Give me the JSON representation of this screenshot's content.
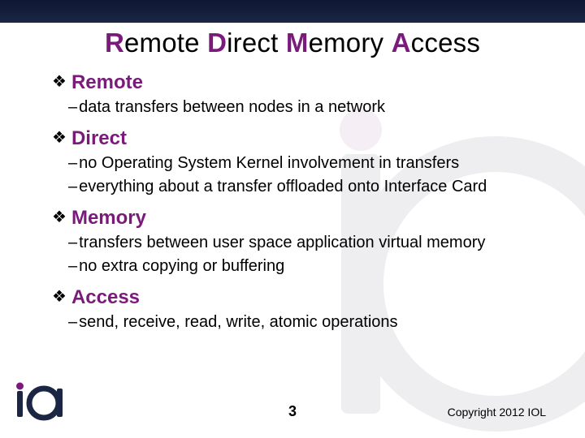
{
  "title": {
    "w1_initial": "R",
    "w1_rest": "emote",
    "w2_initial": "D",
    "w2_rest": "irect",
    "w3_initial": "M",
    "w3_rest": "emory",
    "w4_initial": "A",
    "w4_rest": "ccess"
  },
  "sections": {
    "s1": {
      "head_first": "R",
      "head_rest": "emote",
      "items": [
        "data transfers between nodes in a network"
      ]
    },
    "s2": {
      "head_first": "D",
      "head_rest": "irect",
      "items": [
        "no Operating System Kernel involvement in transfers",
        "everything about a transfer offloaded onto Interface Card"
      ]
    },
    "s3": {
      "head_first": "M",
      "head_rest": "emory",
      "items": [
        "transfers between user space application virtual memory",
        "no extra copying or buffering"
      ]
    },
    "s4": {
      "head_first": "A",
      "head_rest": "ccess",
      "items": [
        "send, receive, read, write, atomic operations"
      ]
    }
  },
  "footer": {
    "page": "3",
    "copyright": "Copyright 2012 IOL"
  },
  "colors": {
    "accent": "#7a1b7c",
    "topbar": "#1a2644"
  }
}
